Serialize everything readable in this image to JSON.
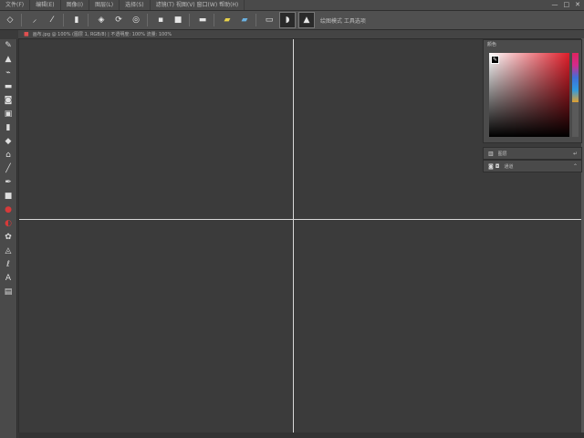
{
  "menubar": {
    "items": [
      "文件(F)",
      "编辑(E)",
      "图像(I)",
      "图层(L)",
      "选择(S)",
      "滤镜(T)  视图(V)  窗口(W)  帮助(H)"
    ],
    "window_controls": [
      "—",
      "□",
      "✕"
    ]
  },
  "toolbar": {
    "icons": [
      "brush-icon",
      "pencil-icon",
      "eraser-icon",
      "lasso-icon",
      "crop-icon",
      "select-icon",
      "fill-icon",
      "move-icon",
      "zoom-icon",
      "text-icon",
      "shape-icon",
      "color-icon"
    ],
    "label": "绘图模式 工具选项"
  },
  "optionsbar": {
    "document_label": "画布.jpg @ 100% (图层 1, RGB/8)  |  不透明度: 100%  流量: 100%"
  },
  "color_panel": {
    "title": "颜色"
  },
  "panels": {
    "layers_row": "图层",
    "channels_row": "通道"
  },
  "colors": {
    "accent_red": "#e01e2a",
    "guide": "#d8d8d8",
    "canvas_bg": "#3b3b3b"
  }
}
